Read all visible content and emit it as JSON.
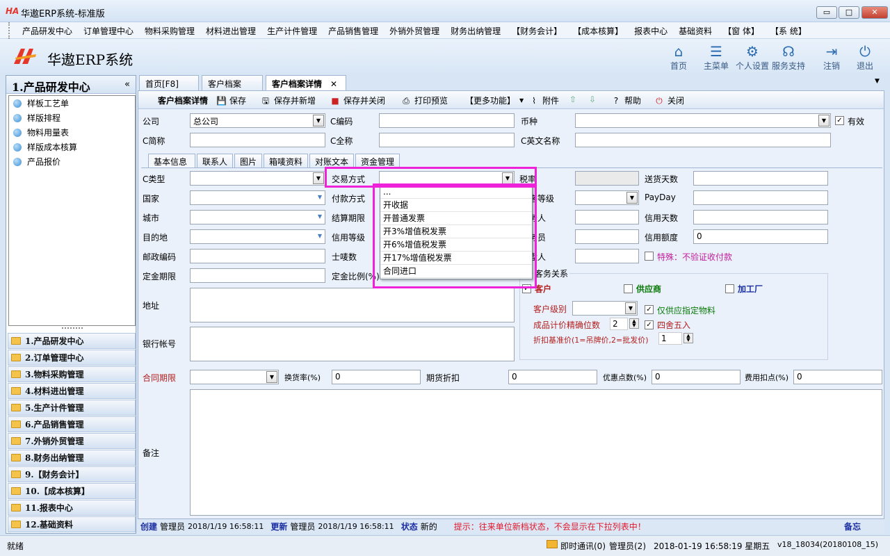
{
  "window": {
    "title": "华遨ERP系统-标准版",
    "logo_text": "HA",
    "min": "▭",
    "max": "□",
    "close": "✕"
  },
  "menu": [
    "产品研发中心",
    "订单管理中心",
    "物料采购管理",
    "材料进出管理",
    "生产计件管理",
    "产品销售管理",
    "外销外贸管理",
    "财务出纳管理",
    "【财务会计】",
    "【成本核算】",
    "报表中心",
    "基础资料",
    "【窗 体】",
    "【系 统】"
  ],
  "brand": {
    "name": "华遨ERP系统"
  },
  "top_icons": [
    {
      "label": "首页",
      "icon": "home-icon",
      "glyph": "⌂"
    },
    {
      "label": "主菜单",
      "icon": "menu-list-icon",
      "glyph": "☰"
    },
    {
      "label": "个人设置",
      "icon": "gear-icon",
      "glyph": "⚙"
    },
    {
      "label": "服务支持",
      "icon": "support-icon",
      "glyph": "☊"
    },
    {
      "label": "注销",
      "icon": "logout-icon",
      "glyph": "⇥"
    },
    {
      "label": "退出",
      "icon": "power-icon",
      "glyph": "⏻"
    }
  ],
  "sidebar": {
    "title": "1.产品研发中心",
    "collapse": "«",
    "tree": [
      "样板工艺单",
      "样版排程",
      "物料用量表",
      "样版成本核算",
      "产品报价"
    ],
    "groups": [
      "1.产品研发中心",
      "2.订单管理中心",
      "3.物料采购管理",
      "4.材料进出管理",
      "5.生产计件管理",
      "6.产品销售管理",
      "7.外销外贸管理",
      "8.财务出纳管理",
      "9.【财务会计】",
      "10.【成本核算】",
      "11.报表中心",
      "12.基础资料"
    ]
  },
  "tabs": [
    {
      "label": "首页[F8]"
    },
    {
      "label": "客户档案"
    },
    {
      "label": "客户档案详情",
      "close": "✕"
    }
  ],
  "tab_menu_arrow": "▼",
  "toolbar": {
    "title": "客户档案详情",
    "save": "保存",
    "save_new": "保存并新增",
    "save_close": "保存并关闭",
    "print": "打印预览",
    "more": "【更多功能】",
    "attach": "附件",
    "help": "帮助",
    "close": "关闭"
  },
  "form": {
    "company_label": "公司",
    "company_value": "总公司",
    "code_label": "C编码",
    "currency_label": "币种",
    "valid_label": "有效",
    "short_label": "C简称",
    "fullname_label": "C全称",
    "engname_label": "C英文名称"
  },
  "subtabs": [
    "基本信息",
    "联系人",
    "图片",
    "箱唛资料",
    "对账文本",
    "资金管理"
  ],
  "basic": {
    "ctype": "C类型",
    "country": "国家",
    "city": "城市",
    "dest": "目的地",
    "postcode": "邮政编码",
    "deposit_term": "定金期限",
    "trade": "交易方式",
    "payment": "付款方式",
    "settle": "结算期限",
    "credit_level": "信用等级",
    "mark": "士唛数",
    "deposit_ratio": "定金比例(%)",
    "tax": "税率",
    "grade": "客等级",
    "person1": "务人",
    "person2": "务员",
    "person3": "盘人",
    "delivery_days": "送货天数",
    "payday": "PayDay",
    "credit_days": "信用天数",
    "credit_amount": "信用额度",
    "credit_amount_value": "0",
    "special": "特殊：不验证收付款",
    "address": "地址",
    "bank": "银行帐号",
    "relation_title": "客务关系",
    "customer": "客户",
    "supplier": "供应商",
    "factory": "加工厂",
    "cust_level": "客户级别",
    "only_supply": "仅供应指定物料",
    "precision": "成品计价精确位数",
    "precision_value": "2",
    "round": "四舍五入",
    "discount_base": "折扣基准价(1=吊牌价,2=批发价)",
    "discount_value": "1",
    "contract_term": "合同期限",
    "exchange_rate": "换货率(%)",
    "exchange_value": "0",
    "futures_discount": "期货折扣",
    "futures_value": "0",
    "promo_points": "优惠点数(%)",
    "promo_value": "0",
    "fee_points": "费用扣点(%)",
    "fee_value": "0",
    "remark": "备注"
  },
  "popup": [
    "...",
    "开收据",
    "开普通发票",
    "开3%增值税发票",
    "开6%增值税发票",
    "开17%增值税发票",
    "合同进口"
  ],
  "footer": {
    "create": "创建",
    "creator": "管理员",
    "create_time": "2018/1/19 16:58:11",
    "update": "更新",
    "updater": "管理员",
    "update_time": "2018/1/19 16:58:11",
    "state": "状态",
    "state_value": "新的",
    "hint": "提示：往来单位新档状态，不会显示在下拉列表中！",
    "memo": "备忘"
  },
  "status": {
    "ready": "就绪",
    "im": "即时通讯(0)",
    "user": "管理员(2)",
    "datetime": "2018-01-19  16:58:19 星期五",
    "version": "v18_18034(20180108_15)"
  },
  "colors": {
    "highlight": "#ee22d8",
    "accent": "#2a6bb1"
  }
}
